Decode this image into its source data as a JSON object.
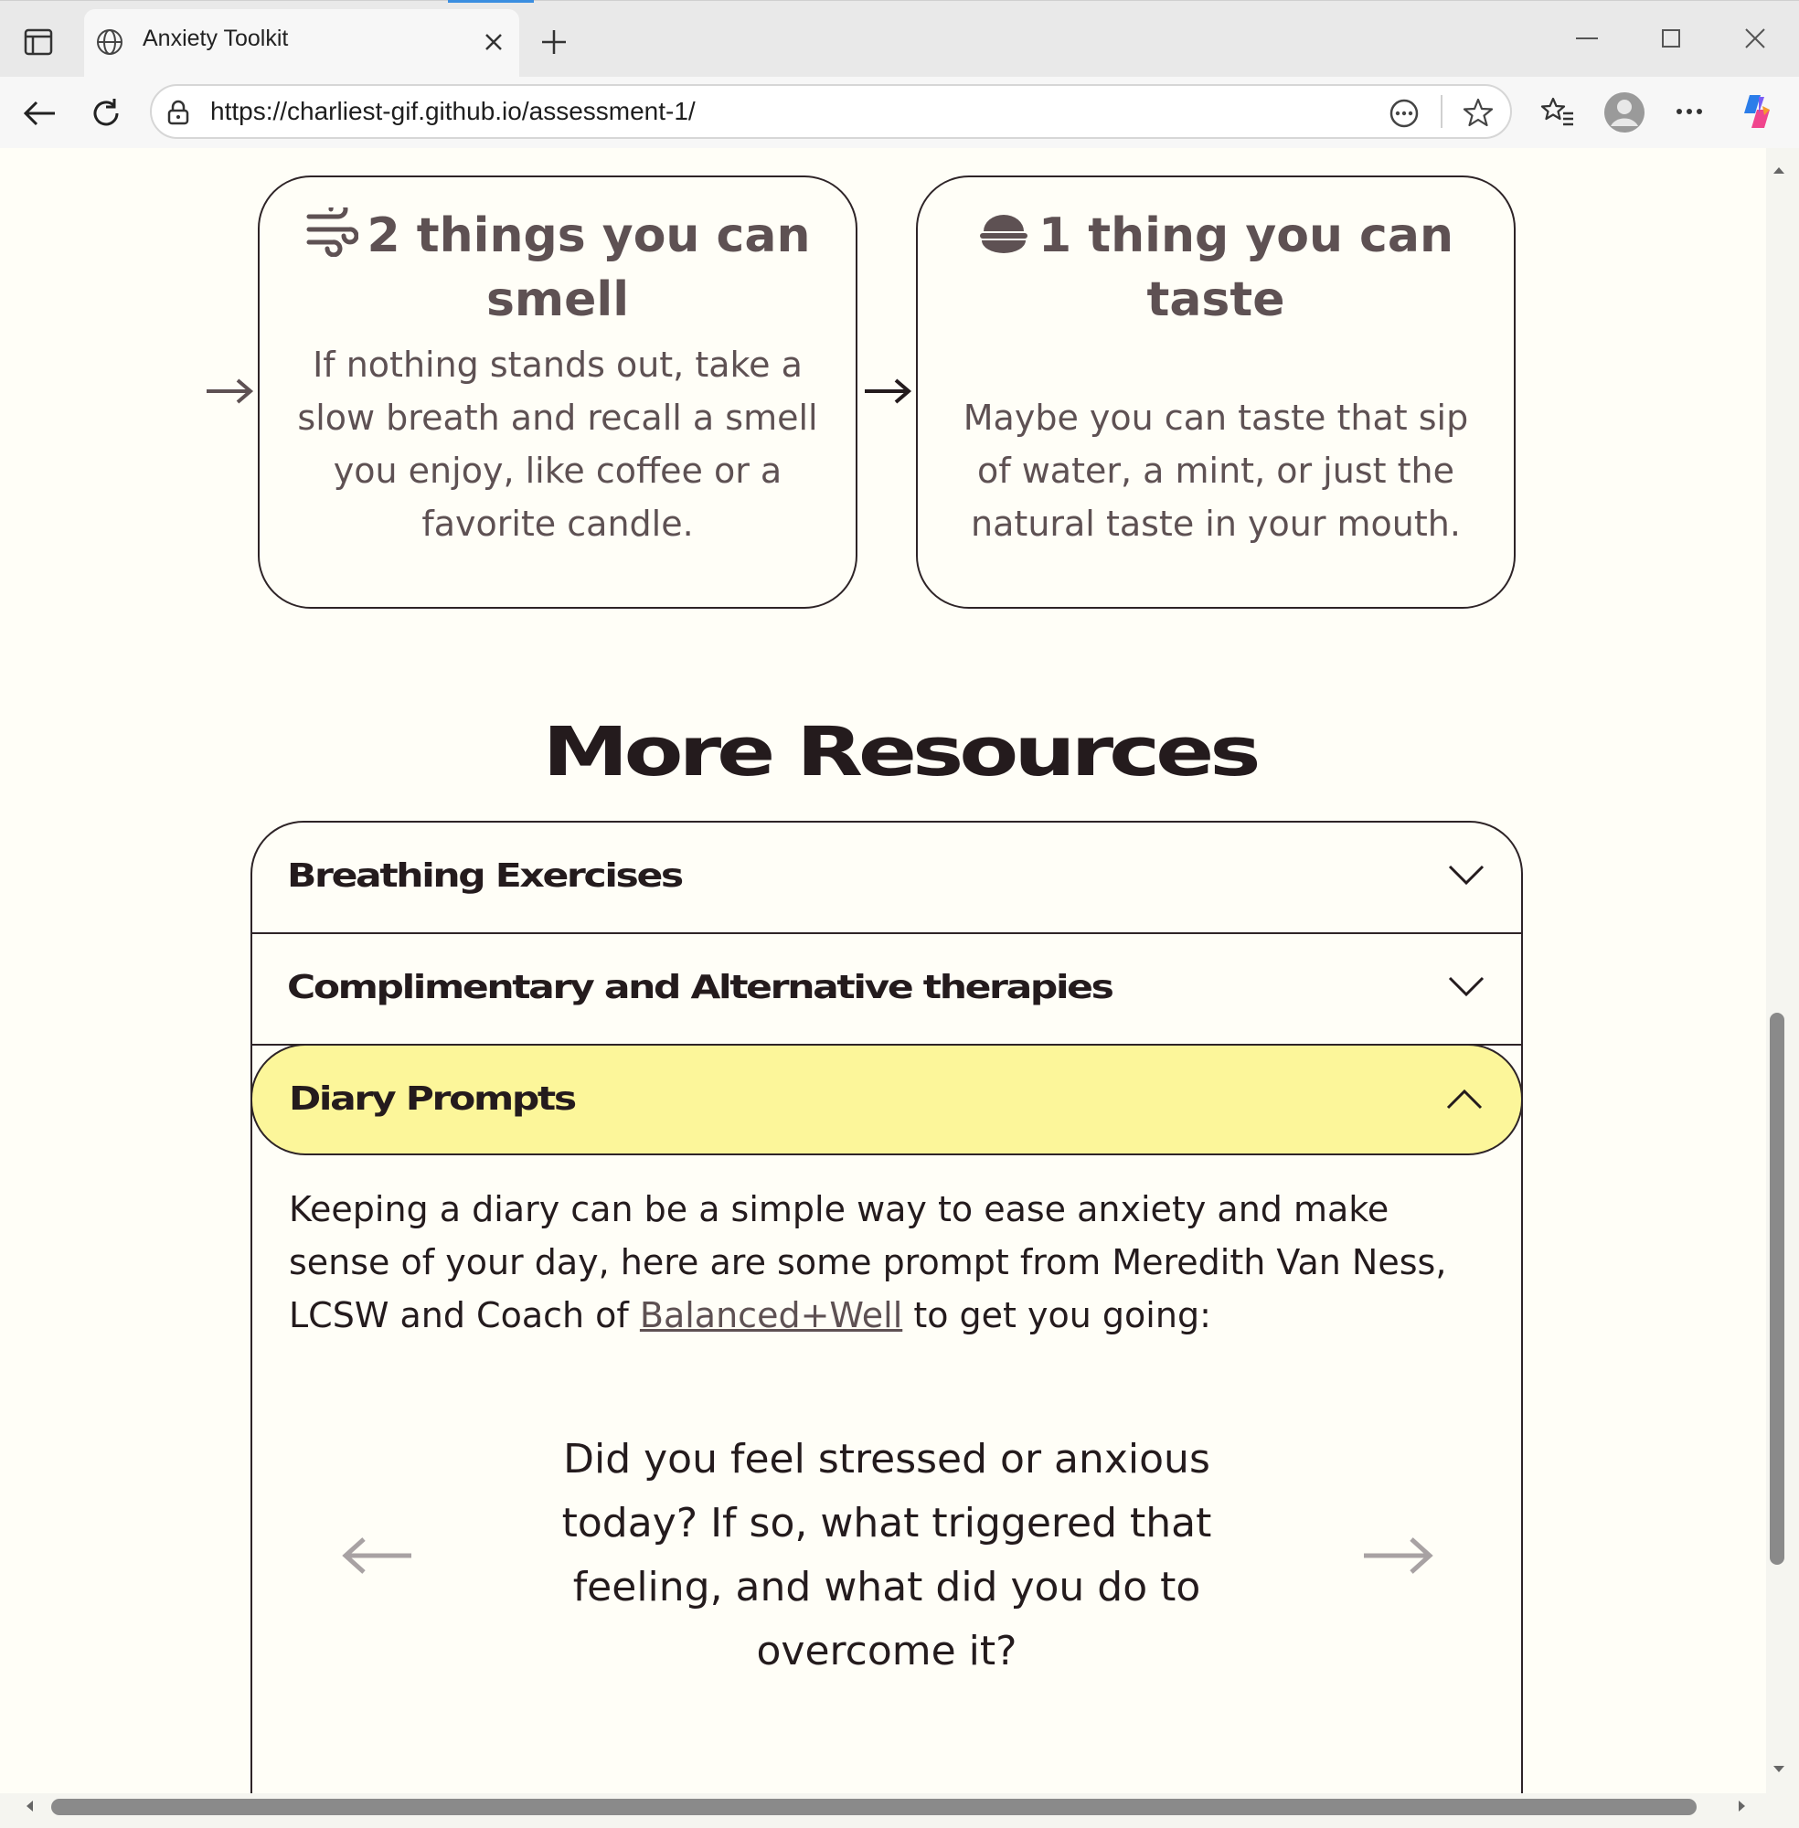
{
  "browser": {
    "tab_title": "Anxiety Toolkit",
    "url": "https://charliest-gif.github.io/assessment-1/"
  },
  "cards": [
    {
      "title": "2 things you can smell",
      "icon": "wind-icon",
      "body": "If nothing stands out, take a slow breath and recall a smell you enjoy, like coffee or a favorite candle."
    },
    {
      "title": "1 thing you can taste",
      "icon": "bowl-icon",
      "body": "Maybe you can taste that sip of water, a mint, or just the natural taste in your mouth."
    }
  ],
  "resources": {
    "heading": "More Resources",
    "items": [
      {
        "label": "Breathing Exercises",
        "expanded": false
      },
      {
        "label": "Complimentary and Alternative therapies",
        "expanded": false
      },
      {
        "label": "Diary Prompts",
        "expanded": true
      }
    ],
    "diary": {
      "intro_before_link": "Keeping a diary can be a simple way to ease anxiety and make sense of your day, here are some prompt from Meredith Van Ness, LCSW and Coach of ",
      "link_text": "Balanced+Well",
      "intro_after_link": " to get you going:",
      "prompt": "Did you feel stressed or anxious today? If so, what triggered that feeling, and what did you do to overcome it?"
    }
  },
  "colors": {
    "accent_highlight": "#fcf69a",
    "text_dark": "#241b1d",
    "text_muted": "#5e5153",
    "page_bg": "#fffef7"
  }
}
